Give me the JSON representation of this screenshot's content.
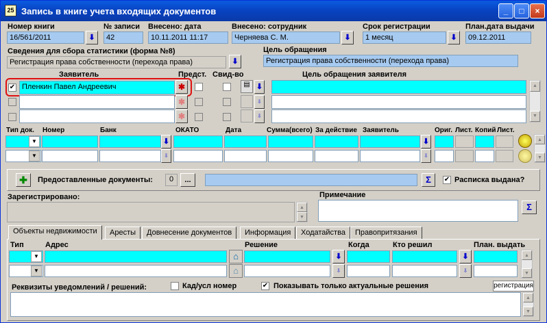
{
  "window": {
    "title": "Запись в книге учета входящих документов",
    "icon": "app-icon",
    "minimize": "_",
    "maximize": "□",
    "close": "×"
  },
  "header": {
    "book_number_label": "Номер книги",
    "book_number": "16/561/2011",
    "record_no_label": "№ записи",
    "record_no": "42",
    "date_label": "Внесено: дата",
    "date": "10.11.2011 11:17",
    "employee_label": "Внесено: сотрудник",
    "employee": "Черняева С. М.",
    "term_label": "Срок регистрации",
    "term": "1 месяц",
    "plan_date_label": "План.дата выдачи",
    "plan_date": "09.12.2011"
  },
  "stats": {
    "label": "Сведения для сбора статистики (форма №8)",
    "value": "Регистрация права собственности (перехода права)"
  },
  "purpose": {
    "label": "Цель обращения",
    "value": "Регистрация права собственности (перехода права)"
  },
  "applicants": {
    "col_applicant": "Заявитель",
    "col_repr": "Предст.",
    "col_cert": "Свид-во",
    "col_purpose": "Цель обращения заявителя",
    "rows": [
      {
        "checked": "✔",
        "name": "Пленкин Павел Андреевич"
      },
      {
        "checked": "",
        "name": ""
      },
      {
        "checked": "",
        "name": ""
      }
    ]
  },
  "payments": {
    "headers": [
      "Тип док.",
      "Номер",
      "Банк",
      "ОКАТО",
      "Дата",
      "Сумма(всего)",
      "За действие",
      "Заявитель",
      "Ориг.",
      "Лист.",
      "Копий",
      "Лист."
    ]
  },
  "provided": {
    "label": "Предоставленные документы:",
    "count": "0",
    "browse": "...",
    "sum": "Σ",
    "receipt_label": "Расписка выдана?",
    "receipt_checked": "✔"
  },
  "registered": {
    "label": "Зарегистрировано:"
  },
  "note": {
    "label": "Примечание",
    "sum": "Σ"
  },
  "tabs": [
    "Объекты недвижимости",
    "Аресты",
    "Довнесение документов",
    "Информация",
    "Ходатайства",
    "Правопритязания"
  ],
  "objects": {
    "col_type": "Тип",
    "col_address": "Адрес",
    "col_decision": "Решение",
    "col_when": "Когда",
    "col_who": "Кто решил",
    "col_plan": "План. выдать"
  },
  "notices": {
    "label": "Реквизиты уведомлений / решений:",
    "cad_label": "Кад/усл номер",
    "cad_checked": "",
    "actual_label": "Показывать только актуальные решения",
    "actual_checked": "✔",
    "reg_button": "регистрация"
  }
}
